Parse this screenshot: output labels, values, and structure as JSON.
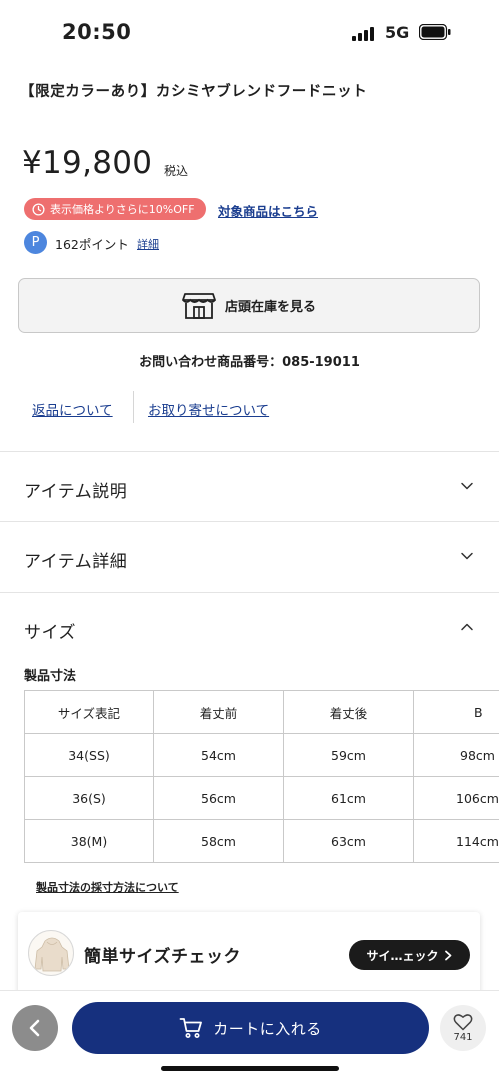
{
  "status_bar": {
    "time": "20:50",
    "network": "5G"
  },
  "product": {
    "title": "【限定カラーあり】カシミヤブレンドフードニット",
    "price": "¥19,800",
    "tax_label": "税込",
    "promo_badge": "表示価格よりさらに10%OFF",
    "promo_link": "対象商品はこちら",
    "points_icon_letter": "P",
    "points_text": "162ポイント",
    "points_detail": "詳細"
  },
  "store_stock_button": "店頭在庫を見る",
  "inquiry_number": "お問い合わせ商品番号：085-19011",
  "links": {
    "returns": "返品について",
    "order": "お取り寄せについて"
  },
  "accordions": [
    {
      "title": "アイテム説明",
      "expanded": false
    },
    {
      "title": "アイテム詳細",
      "expanded": false
    },
    {
      "title": "サイズ",
      "expanded": true
    }
  ],
  "size": {
    "subtitle": "製品寸法",
    "headers": [
      "サイズ表記",
      "着丈前",
      "着丈後",
      "B"
    ],
    "rows": [
      [
        "34(SS)",
        "54cm",
        "59cm",
        "98cm"
      ],
      [
        "36(S)",
        "56cm",
        "61cm",
        "106cm"
      ],
      [
        "38(M)",
        "58cm",
        "63cm",
        "114cm"
      ]
    ],
    "measure_link": "製品寸法の採寸方法について"
  },
  "size_check": {
    "title": "簡単サイズチェック",
    "button": "サイ…ェック"
  },
  "bottom_bar": {
    "cart_button": "カートに入れる",
    "favorite_count": "741"
  },
  "colors": {
    "accent_navy": "#16307e",
    "link_blue": "#1a3d8f",
    "promo_red": "#ee6f6f",
    "points_blue": "#4d86de"
  }
}
